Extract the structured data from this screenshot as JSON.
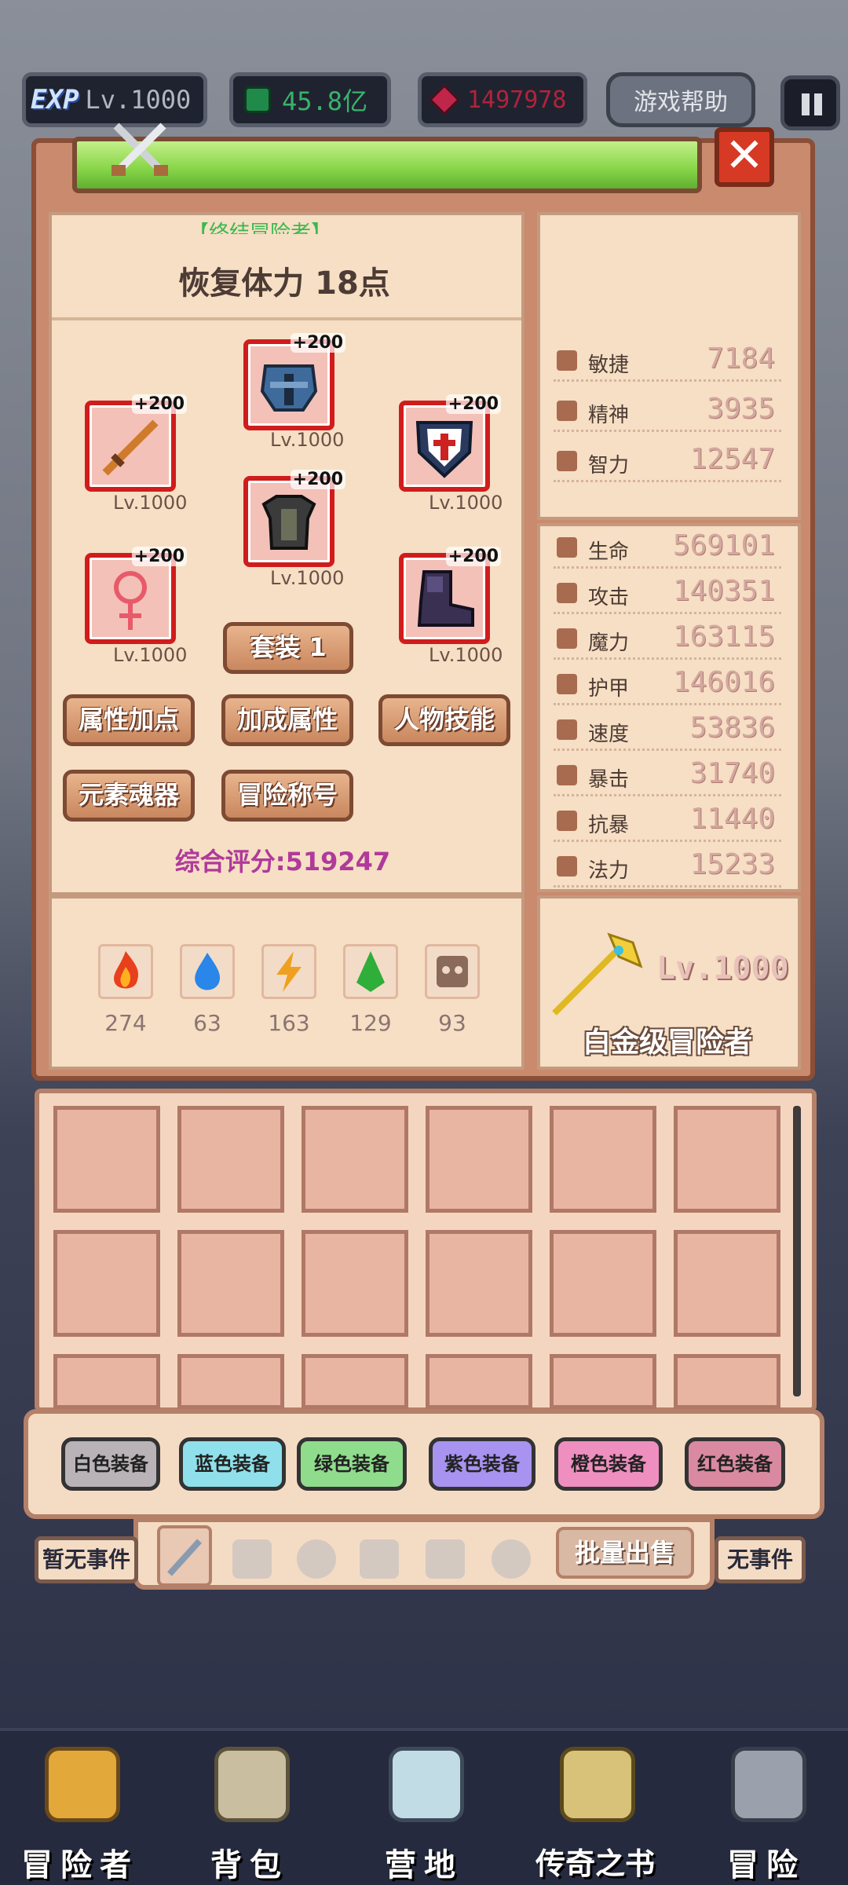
{
  "hud": {
    "exp_badge": "EXP",
    "level": "Lv.1000",
    "gems": "45.8亿",
    "rubies": "1497978",
    "help": "游戏帮助"
  },
  "panel": {
    "subtitle_partial": "【终结冒险者】",
    "stamina": "恢复体力 18点",
    "close": "✕"
  },
  "equipment": {
    "plus": "+200",
    "slots": [
      {
        "name": "helmet",
        "level": "Lv.1000"
      },
      {
        "name": "weapon",
        "level": "Lv.1000"
      },
      {
        "name": "shield",
        "level": "Lv.1000"
      },
      {
        "name": "armor",
        "level": "Lv.1000"
      },
      {
        "name": "necklace",
        "level": "Lv.1000"
      },
      {
        "name": "boots",
        "level": "Lv.1000"
      }
    ],
    "set_button": "套装 1"
  },
  "actions": {
    "attr_points": "属性加点",
    "bonus_attr": "加成属性",
    "char_skills": "人物技能",
    "element_soul": "元素魂器",
    "adv_title": "冒险称号"
  },
  "score": "综合评分:519247",
  "stats_top": [
    {
      "name": "敏捷",
      "value": "7184"
    },
    {
      "name": "精神",
      "value": "3935"
    },
    {
      "name": "智力",
      "value": "12547"
    }
  ],
  "stats_main": [
    {
      "name": "生命",
      "value": "569101"
    },
    {
      "name": "攻击",
      "value": "140351"
    },
    {
      "name": "魔力",
      "value": "163115"
    },
    {
      "name": "护甲",
      "value": "146016"
    },
    {
      "name": "速度",
      "value": "53836"
    },
    {
      "name": "暴击",
      "value": "31740"
    },
    {
      "name": "抗暴",
      "value": "11440"
    },
    {
      "name": "法力",
      "value": "15233"
    }
  ],
  "elements": [
    {
      "icon": "fire-icon",
      "count": "274"
    },
    {
      "icon": "water-icon",
      "count": "63"
    },
    {
      "icon": "thunder-icon",
      "count": "163"
    },
    {
      "icon": "wind-icon",
      "count": "129"
    },
    {
      "icon": "dark-icon",
      "count": "93"
    }
  ],
  "rank": {
    "level": "Lv.1000",
    "title": "白金级冒险者"
  },
  "filters": [
    {
      "label": "白色装备",
      "color": "#b9b3b7"
    },
    {
      "label": "蓝色装备",
      "color": "#8fe0ea"
    },
    {
      "label": "绿色装备",
      "color": "#8fdc8c"
    },
    {
      "label": "紫色装备",
      "color": "#a893f0"
    },
    {
      "label": "橙色装备",
      "color": "#ee8fbf"
    },
    {
      "label": "红色装备",
      "color": "#d98aa0"
    }
  ],
  "bulk_sell": "批量出售",
  "side_events": {
    "left": "暂无事件",
    "right": "无事件"
  },
  "nav": [
    {
      "label": "冒险者"
    },
    {
      "label": "背包"
    },
    {
      "label": "营地"
    },
    {
      "label": "传奇之书"
    },
    {
      "label": "冒险"
    }
  ]
}
